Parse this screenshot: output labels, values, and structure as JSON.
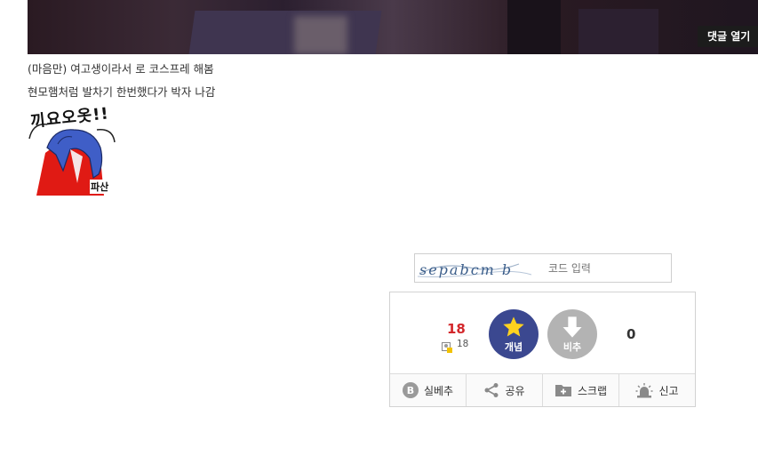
{
  "hero": {
    "comment_open_label": "댓글 열기"
  },
  "post": {
    "line1": "(마음만) 여고생이라서 로 코스프레 해봄",
    "line2": "현모햄처럼 발차기 한번했다가 박자 나감"
  },
  "meme": {
    "title": "끼요오옷!!",
    "caption": "파산"
  },
  "captcha": {
    "image_text": "sepabcm b",
    "placeholder": "코드 입력"
  },
  "recommend": {
    "up_count": "18",
    "fixed_count": "18",
    "up_label": "개념",
    "down_label": "비추",
    "down_count": "0",
    "actions": [
      {
        "label": "실베추",
        "icon": "b-badge-icon"
      },
      {
        "label": "공유",
        "icon": "share-icon"
      },
      {
        "label": "스크랩",
        "icon": "scrap-folder-icon"
      },
      {
        "label": "신고",
        "icon": "siren-icon"
      }
    ]
  },
  "colors": {
    "up_button": "#3b4890",
    "down_button": "#b3b3b3",
    "up_count": "#d3272b",
    "star": "#ffd21f"
  }
}
